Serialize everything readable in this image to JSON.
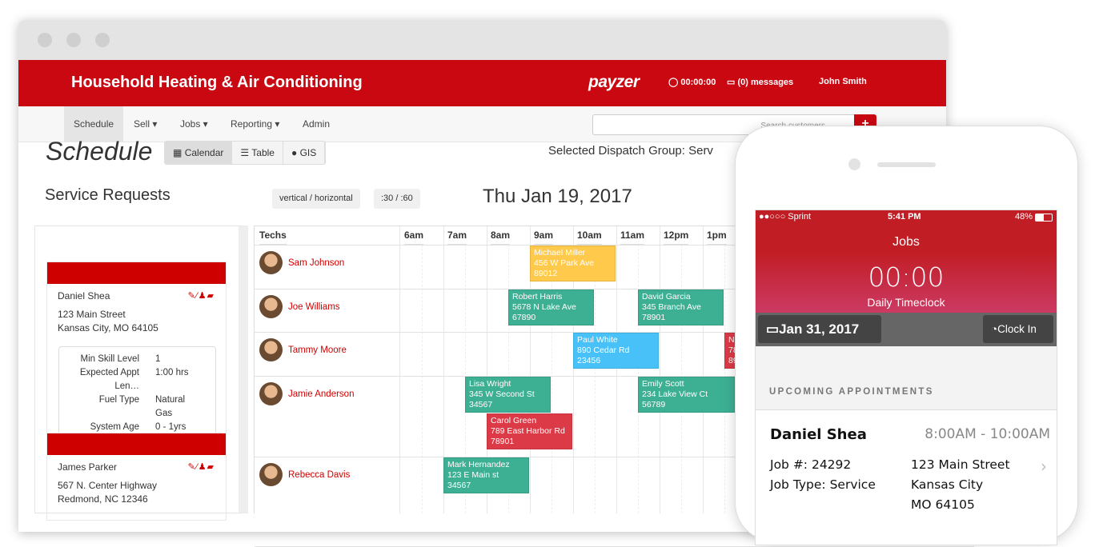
{
  "header": {
    "app_title": "Household Heating & Air Conditioning",
    "logo": "payzer",
    "timer": "00:00:00",
    "messages": "(0) messages",
    "user": "John Smith"
  },
  "nav": {
    "items": [
      {
        "label": "Schedule"
      },
      {
        "label": "Sell ▾"
      },
      {
        "label": "Jobs ▾"
      },
      {
        "label": "Reporting ▾"
      },
      {
        "label": "Admin"
      }
    ],
    "search_placeholder": "Search customers",
    "add_label": "+"
  },
  "page": {
    "title": "Schedule",
    "views": [
      {
        "icon": "calendar-icon",
        "glyph": "▦",
        "label": "Calendar"
      },
      {
        "icon": "list-icon",
        "glyph": "☰",
        "label": "Table"
      },
      {
        "icon": "globe-icon",
        "glyph": "●",
        "label": "GIS"
      }
    ],
    "dispatch": "Selected Dispatch Group: Serv",
    "service_requests": "Service Requests",
    "orientation": "vertical / horizontal",
    "interval": ":30 / :60",
    "date": "Thu Jan 19, 2017"
  },
  "requests": [
    {
      "name": "Daniel Shea",
      "icons": "✎⁄♟▰",
      "address1": "123 Main Street",
      "address2": "Kansas City, MO 64105",
      "details": [
        {
          "k": "Min Skill Level",
          "v": "1"
        },
        {
          "k": "Expected Appt Len…",
          "v": "1:00 hrs"
        },
        {
          "k": "Fuel Type",
          "v": "Natural Gas"
        },
        {
          "k": "System Age",
          "v": "0 - 1yrs"
        }
      ]
    },
    {
      "name": "James Parker",
      "icons": "✎⁄♟▰",
      "address1": "567 N. Center Highway",
      "address2": "Redmond, NC 12346"
    }
  ],
  "calendar": {
    "techs_label": "Techs",
    "hours": [
      "6am",
      "7am",
      "8am",
      "9am",
      "10am",
      "11am",
      "12pm",
      "1pm"
    ],
    "techs": [
      "Sam Johnson",
      "Joe Williams",
      "Tammy Moore",
      "Jamie Anderson",
      "Rebecca Davis"
    ],
    "events": [
      {
        "tech": 0,
        "lane": 0,
        "start": 9,
        "end": 11,
        "name": "Michael Miller",
        "addr": "456 W Park Ave",
        "zip": "89012",
        "color": "#ffc94b"
      },
      {
        "tech": 1,
        "lane": 0,
        "start": 8.5,
        "end": 10.5,
        "name": "Robert Harris",
        "addr": "5678 N Lake Ave",
        "zip": "67890",
        "color": "#3daf93"
      },
      {
        "tech": 1,
        "lane": 0,
        "start": 11.5,
        "end": 13.5,
        "name": "David Garcia",
        "addr": "345 Branch Ave",
        "zip": "78901",
        "color": "#3daf93"
      },
      {
        "tech": 2,
        "lane": 0,
        "start": 10,
        "end": 12,
        "name": "Paul White",
        "addr": "890 Cedar Rd",
        "zip": "23456",
        "color": "#47c1f7"
      },
      {
        "tech": 2,
        "lane": 0,
        "start": 13.5,
        "end": 15.5,
        "name": "N",
        "addr": "78",
        "zip": "89",
        "color": "#dc3a47"
      },
      {
        "tech": 3,
        "lane": 0,
        "start": 7.5,
        "end": 9.5,
        "name": "Lisa Wright",
        "addr": "345 W Second St",
        "zip": "34567",
        "color": "#3daf93"
      },
      {
        "tech": 3,
        "lane": 1,
        "start": 8,
        "end": 10,
        "name": "Carol Green",
        "addr": "789 East Harbor Rd",
        "zip": "78901",
        "color": "#dc3a47"
      },
      {
        "tech": 3,
        "lane": 0,
        "start": 11.5,
        "end": 13.75,
        "name": "Emily Scott",
        "addr": "234 Lake View Ct",
        "zip": "56789",
        "color": "#3daf93"
      },
      {
        "tech": 4,
        "lane": 0,
        "start": 7,
        "end": 9,
        "name": "Mark Hernandez",
        "addr": "123 E Main st",
        "zip": "34567",
        "color": "#3daf93"
      }
    ]
  },
  "mobile": {
    "status": {
      "carrier": "●●○○○ Sprint",
      "time": "5:41 PM",
      "battery": "48%"
    },
    "title": "Jobs",
    "timer": "00:00",
    "timer_label": "Daily Timeclock",
    "date": "Jan 31, 2017",
    "clock_in": "Clock In",
    "upcoming": "UPCOMING APPOINTMENTS",
    "appointment": {
      "name": "Daniel Shea",
      "time": "8:00AM - 10:00AM",
      "job_no": "Job #: 24292",
      "job_type": "Job Type: Service",
      "addr1": "123 Main Street",
      "addr2": "Kansas City",
      "addr3": "MO 64105"
    }
  }
}
